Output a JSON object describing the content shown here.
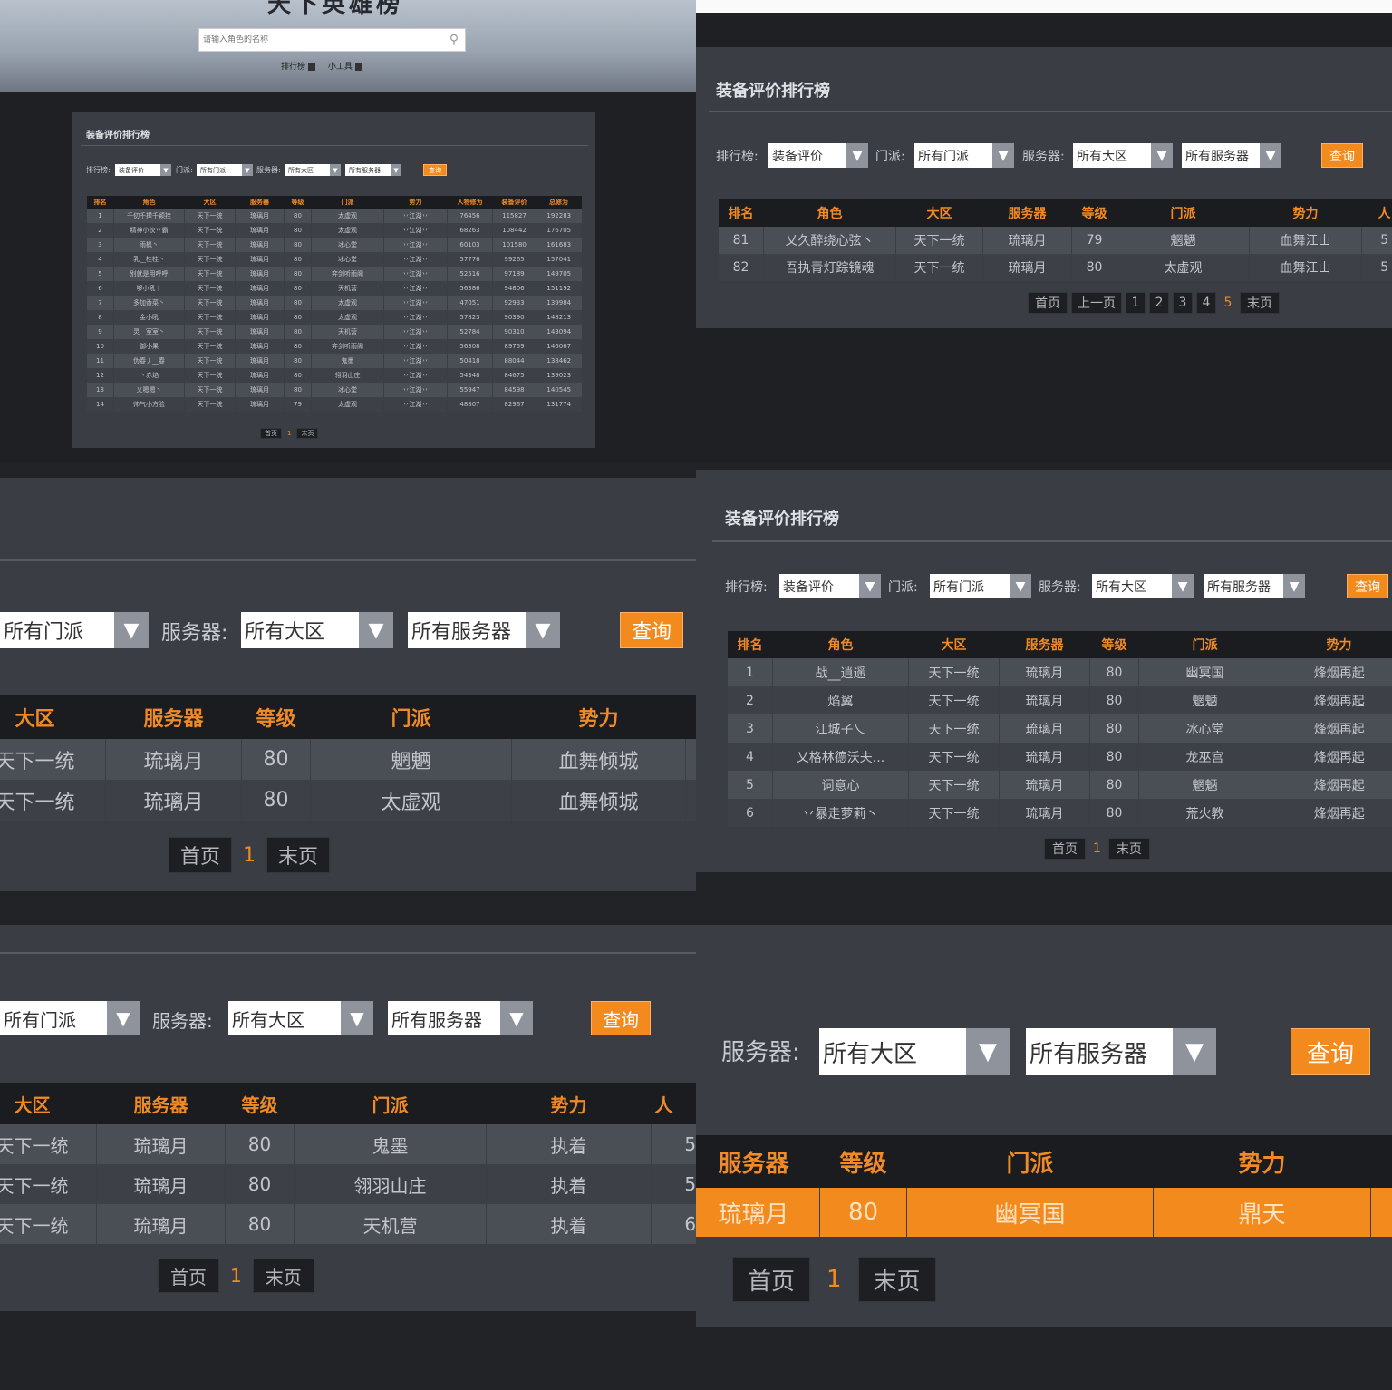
{
  "colors": {
    "accent": "#f38a1e",
    "header_bg": "#1b1c1f",
    "panel_bg": "#3a3d44",
    "page_bg": "#222326",
    "row_highlight": "#f38a1e"
  },
  "common": {
    "panel_title": "装备评价排行榜",
    "rank_label": "排行榜:",
    "sect_label": "门派:",
    "server_label": "服务器:",
    "rank_value": "装备评价",
    "sect_value": "所有门派",
    "region_value": "所有大区",
    "server_value": "所有服务器",
    "query": "查询",
    "first_page": "首页",
    "prev_page": "上一页",
    "last_page": "末页",
    "current_page": "1"
  },
  "top_page": {
    "site_title": "天下英雄榜",
    "search_placeholder": "请输入角色的名称",
    "nav": [
      "排行榜",
      "小工具"
    ],
    "headers": [
      "排名",
      "角色",
      "大区",
      "服务器",
      "等级",
      "门派",
      "势力",
      "人物修为",
      "装备评价",
      "总修为"
    ],
    "rows": [
      [
        "1",
        "千仞千撵千颖拴",
        "天下一统",
        "琉璃月",
        "80",
        "太虚观",
        "丷江湖丷",
        "76456",
        "115827",
        "192283"
      ],
      [
        "2",
        "精神小伙丷霸",
        "天下一统",
        "琉璃月",
        "80",
        "太虚观",
        "丷江湖丷",
        "68263",
        "108442",
        "176705"
      ],
      [
        "3",
        "雨枫丶",
        "天下一统",
        "琉璃月",
        "80",
        "冰心堂",
        "丷江湖丷",
        "60103",
        "101580",
        "161683"
      ],
      [
        "4",
        "乳__桂桂丶",
        "天下一统",
        "琉璃月",
        "80",
        "冰心堂",
        "丷江湖丷",
        "57776",
        "99265",
        "157041"
      ],
      [
        "5",
        "别就是用呼呼",
        "天下一统",
        "琉璃月",
        "80",
        "弈剑听雨阁",
        "丷江湖丷",
        "52516",
        "97189",
        "149705"
      ],
      [
        "6",
        "够小吼丨",
        "天下一统",
        "琉璃月",
        "80",
        "天机营",
        "丷江湖丷",
        "56386",
        "94806",
        "151192"
      ],
      [
        "7",
        "多加香菜丶",
        "天下一统",
        "琉璃月",
        "80",
        "太虚观",
        "丷江湖丷",
        "47051",
        "92933",
        "139984"
      ],
      [
        "8",
        "金小吼",
        "天下一统",
        "琉璃月",
        "80",
        "太虚观",
        "丷江湖丷",
        "57823",
        "90390",
        "148213"
      ],
      [
        "9",
        "灵__室室丶",
        "天下一统",
        "琉璃月",
        "80",
        "天机营",
        "丷江湖丷",
        "52784",
        "90310",
        "143094"
      ],
      [
        "10",
        "御小果",
        "天下一统",
        "琉璃月",
        "80",
        "弈剑听雨阁",
        "丷江湖丷",
        "56308",
        "89759",
        "146067"
      ],
      [
        "11",
        "伪春丿__春",
        "天下一统",
        "琉璃月",
        "80",
        "鬼墨",
        "丷江湖丷",
        "50418",
        "88044",
        "138462"
      ],
      [
        "12",
        "丶赤焰",
        "天下一统",
        "琉璃月",
        "80",
        "翎羽山庄",
        "丷江湖丷",
        "54348",
        "84675",
        "139023"
      ],
      [
        "13",
        "乂嗯嗯丶",
        "天下一统",
        "琉璃月",
        "80",
        "冰心堂",
        "丷江湖丷",
        "55947",
        "84598",
        "140545"
      ],
      [
        "14",
        "帅气小方脸",
        "天下一统",
        "琉璃月",
        "79",
        "太虚观",
        "丷江湖丷",
        "48807",
        "82967",
        "131774"
      ]
    ]
  },
  "panel_b": {
    "headers": [
      "排名",
      "角色",
      "大区",
      "服务器",
      "等级",
      "门派",
      "势力",
      "人"
    ],
    "rows": [
      [
        "81",
        "乂久醉绕心弦丶",
        "天下一统",
        "琉璃月",
        "79",
        "魍魉",
        "血舞江山",
        "5"
      ],
      [
        "82",
        "吾执青灯踪镜魂",
        "天下一统",
        "琉璃月",
        "80",
        "太虚观",
        "血舞江山",
        "5"
      ]
    ],
    "pages": [
      "1",
      "2",
      "3",
      "4",
      "5"
    ]
  },
  "panel_c": {
    "headers": [
      "大区",
      "服务器",
      "等级",
      "门派",
      "势力"
    ],
    "rows": [
      [
        "天下一统",
        "琉璃月",
        "80",
        "魍魉",
        "血舞倾城"
      ],
      [
        "天下一统",
        "琉璃月",
        "80",
        "太虚观",
        "血舞倾城"
      ]
    ]
  },
  "panel_d": {
    "headers": [
      "排名",
      "角色",
      "大区",
      "服务器",
      "等级",
      "门派",
      "势力"
    ],
    "rows": [
      [
        "1",
        "战__逍遥",
        "天下一统",
        "琉璃月",
        "80",
        "幽冥国",
        "烽烟再起"
      ],
      [
        "2",
        "焰翼",
        "天下一统",
        "琉璃月",
        "80",
        "魍魉",
        "烽烟再起"
      ],
      [
        "3",
        "江城子乀",
        "天下一统",
        "琉璃月",
        "80",
        "冰心堂",
        "烽烟再起"
      ],
      [
        "4",
        "乂格林德沃夫...",
        "天下一统",
        "琉璃月",
        "80",
        "龙巫宫",
        "烽烟再起"
      ],
      [
        "5",
        "词意心",
        "天下一统",
        "琉璃月",
        "80",
        "魍魉",
        "烽烟再起"
      ],
      [
        "6",
        "丷暴走萝莉丶",
        "天下一统",
        "琉璃月",
        "80",
        "荒火教",
        "烽烟再起"
      ]
    ]
  },
  "panel_e": {
    "headers": [
      "大区",
      "服务器",
      "等级",
      "门派",
      "势力",
      "人"
    ],
    "rows": [
      [
        "天下一统",
        "琉璃月",
        "80",
        "鬼墨",
        "执着",
        "5"
      ],
      [
        "天下一统",
        "琉璃月",
        "80",
        "翎羽山庄",
        "执着",
        "5"
      ],
      [
        "天下一统",
        "琉璃月",
        "80",
        "天机营",
        "执着",
        "6"
      ]
    ]
  },
  "panel_f": {
    "headers": [
      "服务器",
      "等级",
      "门派",
      "势力"
    ],
    "rows": [
      [
        "琉璃月",
        "80",
        "幽冥国",
        "鼎天"
      ]
    ]
  }
}
